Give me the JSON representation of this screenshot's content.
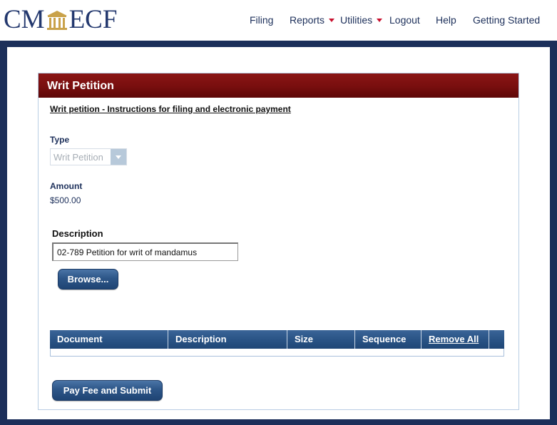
{
  "header": {
    "logo": {
      "left_text": "CM",
      "right_text": "ECF"
    },
    "nav": [
      {
        "label": "Filing",
        "has_menu": false
      },
      {
        "label": "Reports",
        "has_menu": true
      },
      {
        "label": "Utilities",
        "has_menu": true
      },
      {
        "label": "Logout",
        "has_menu": false
      },
      {
        "label": "Help",
        "has_menu": false
      },
      {
        "label": "Getting Started",
        "has_menu": false
      }
    ]
  },
  "panel": {
    "title": "Writ Petition",
    "instructions_link": "Writ petition - Instructions for filing and electronic payment",
    "type_label": "Type",
    "type_value": "Writ Petition",
    "amount_label": "Amount",
    "amount_value": "$500.00",
    "description_label": "Description",
    "description_value": "02-789 Petition for writ of mandamus",
    "browse_button": "Browse...",
    "table": {
      "columns": [
        "Document",
        "Description",
        "Size",
        "Sequence"
      ],
      "remove_all": "Remove All",
      "rows": []
    },
    "submit_button": "Pay Fee and Submit"
  },
  "colors": {
    "navy": "#1c2f5a",
    "header_red": "#7a0f0f",
    "button_blue": "#2d5688",
    "menu_caret": "#c8102e"
  }
}
